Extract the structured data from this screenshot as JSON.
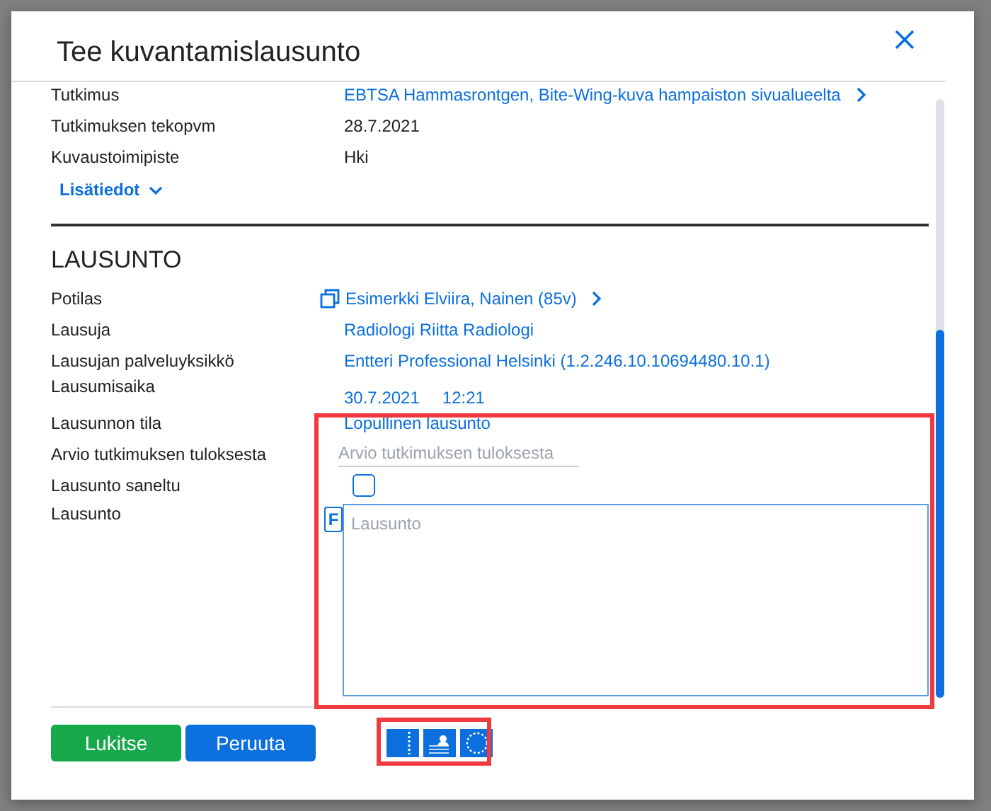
{
  "dialog": {
    "title": "Tee kuvantamislausunto"
  },
  "details": [
    {
      "label": "Tutkimus",
      "value": "EBTSA Hammasrontgen, Bite-Wing-kuva hampaiston sivualueelta",
      "kind": "nav"
    },
    {
      "label": "Tutkimuksen tekopvm",
      "value": "28.7.2021",
      "kind": "text"
    },
    {
      "label": "Kuvaustoimipiste",
      "value": "Hki",
      "kind": "text"
    }
  ],
  "more_link": "Lisätiedot",
  "section": {
    "heading": "LAUSUNTO",
    "fields": [
      {
        "label": "Potilas",
        "value": "Esimerkki Elviira, Nainen (85v)",
        "kind": "patient"
      },
      {
        "label": "Lausuja",
        "value": "Radiologi Riitta Radiologi",
        "kind": "link"
      },
      {
        "label": "Lausujan palveluyksikkö",
        "value": "Entteri Professional Helsinki (1.2.246.10.10694480.10.1)",
        "kind": "link"
      },
      {
        "label": "Lausumisaika",
        "date": "30.7.2021",
        "time": "12:21",
        "kind": "datetime"
      },
      {
        "label": "Lausunnon tila",
        "value": "Lopullinen lausunto",
        "kind": "link"
      },
      {
        "label": "Arvio tutkimuksen tuloksesta",
        "placeholder": "Arvio tutkimuksen tuloksesta",
        "kind": "input"
      },
      {
        "label": "Lausunto saneltu",
        "checked": false,
        "kind": "checkbox"
      },
      {
        "label": "Lausunto",
        "placeholder": "Lausunto",
        "format_button": "F",
        "kind": "textarea"
      }
    ]
  },
  "buttons": [
    {
      "label": "Lukitse",
      "kind": "confirm"
    },
    {
      "label": "Peruuta",
      "kind": "cancel"
    }
  ]
}
